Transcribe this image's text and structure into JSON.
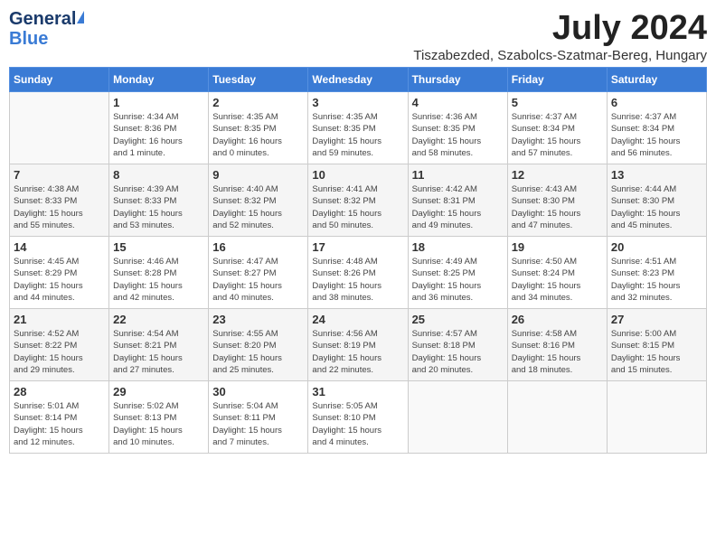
{
  "header": {
    "logo_general": "General",
    "logo_blue": "Blue",
    "month_title": "July 2024",
    "location": "Tiszabezded, Szabolcs-Szatmar-Bereg, Hungary"
  },
  "days_of_week": [
    "Sunday",
    "Monday",
    "Tuesday",
    "Wednesday",
    "Thursday",
    "Friday",
    "Saturday"
  ],
  "weeks": [
    [
      {
        "day": "",
        "info": ""
      },
      {
        "day": "1",
        "info": "Sunrise: 4:34 AM\nSunset: 8:36 PM\nDaylight: 16 hours\nand 1 minute."
      },
      {
        "day": "2",
        "info": "Sunrise: 4:35 AM\nSunset: 8:35 PM\nDaylight: 16 hours\nand 0 minutes."
      },
      {
        "day": "3",
        "info": "Sunrise: 4:35 AM\nSunset: 8:35 PM\nDaylight: 15 hours\nand 59 minutes."
      },
      {
        "day": "4",
        "info": "Sunrise: 4:36 AM\nSunset: 8:35 PM\nDaylight: 15 hours\nand 58 minutes."
      },
      {
        "day": "5",
        "info": "Sunrise: 4:37 AM\nSunset: 8:34 PM\nDaylight: 15 hours\nand 57 minutes."
      },
      {
        "day": "6",
        "info": "Sunrise: 4:37 AM\nSunset: 8:34 PM\nDaylight: 15 hours\nand 56 minutes."
      }
    ],
    [
      {
        "day": "7",
        "info": "Sunrise: 4:38 AM\nSunset: 8:33 PM\nDaylight: 15 hours\nand 55 minutes."
      },
      {
        "day": "8",
        "info": "Sunrise: 4:39 AM\nSunset: 8:33 PM\nDaylight: 15 hours\nand 53 minutes."
      },
      {
        "day": "9",
        "info": "Sunrise: 4:40 AM\nSunset: 8:32 PM\nDaylight: 15 hours\nand 52 minutes."
      },
      {
        "day": "10",
        "info": "Sunrise: 4:41 AM\nSunset: 8:32 PM\nDaylight: 15 hours\nand 50 minutes."
      },
      {
        "day": "11",
        "info": "Sunrise: 4:42 AM\nSunset: 8:31 PM\nDaylight: 15 hours\nand 49 minutes."
      },
      {
        "day": "12",
        "info": "Sunrise: 4:43 AM\nSunset: 8:30 PM\nDaylight: 15 hours\nand 47 minutes."
      },
      {
        "day": "13",
        "info": "Sunrise: 4:44 AM\nSunset: 8:30 PM\nDaylight: 15 hours\nand 45 minutes."
      }
    ],
    [
      {
        "day": "14",
        "info": "Sunrise: 4:45 AM\nSunset: 8:29 PM\nDaylight: 15 hours\nand 44 minutes."
      },
      {
        "day": "15",
        "info": "Sunrise: 4:46 AM\nSunset: 8:28 PM\nDaylight: 15 hours\nand 42 minutes."
      },
      {
        "day": "16",
        "info": "Sunrise: 4:47 AM\nSunset: 8:27 PM\nDaylight: 15 hours\nand 40 minutes."
      },
      {
        "day": "17",
        "info": "Sunrise: 4:48 AM\nSunset: 8:26 PM\nDaylight: 15 hours\nand 38 minutes."
      },
      {
        "day": "18",
        "info": "Sunrise: 4:49 AM\nSunset: 8:25 PM\nDaylight: 15 hours\nand 36 minutes."
      },
      {
        "day": "19",
        "info": "Sunrise: 4:50 AM\nSunset: 8:24 PM\nDaylight: 15 hours\nand 34 minutes."
      },
      {
        "day": "20",
        "info": "Sunrise: 4:51 AM\nSunset: 8:23 PM\nDaylight: 15 hours\nand 32 minutes."
      }
    ],
    [
      {
        "day": "21",
        "info": "Sunrise: 4:52 AM\nSunset: 8:22 PM\nDaylight: 15 hours\nand 29 minutes."
      },
      {
        "day": "22",
        "info": "Sunrise: 4:54 AM\nSunset: 8:21 PM\nDaylight: 15 hours\nand 27 minutes."
      },
      {
        "day": "23",
        "info": "Sunrise: 4:55 AM\nSunset: 8:20 PM\nDaylight: 15 hours\nand 25 minutes."
      },
      {
        "day": "24",
        "info": "Sunrise: 4:56 AM\nSunset: 8:19 PM\nDaylight: 15 hours\nand 22 minutes."
      },
      {
        "day": "25",
        "info": "Sunrise: 4:57 AM\nSunset: 8:18 PM\nDaylight: 15 hours\nand 20 minutes."
      },
      {
        "day": "26",
        "info": "Sunrise: 4:58 AM\nSunset: 8:16 PM\nDaylight: 15 hours\nand 18 minutes."
      },
      {
        "day": "27",
        "info": "Sunrise: 5:00 AM\nSunset: 8:15 PM\nDaylight: 15 hours\nand 15 minutes."
      }
    ],
    [
      {
        "day": "28",
        "info": "Sunrise: 5:01 AM\nSunset: 8:14 PM\nDaylight: 15 hours\nand 12 minutes."
      },
      {
        "day": "29",
        "info": "Sunrise: 5:02 AM\nSunset: 8:13 PM\nDaylight: 15 hours\nand 10 minutes."
      },
      {
        "day": "30",
        "info": "Sunrise: 5:04 AM\nSunset: 8:11 PM\nDaylight: 15 hours\nand 7 minutes."
      },
      {
        "day": "31",
        "info": "Sunrise: 5:05 AM\nSunset: 8:10 PM\nDaylight: 15 hours\nand 4 minutes."
      },
      {
        "day": "",
        "info": ""
      },
      {
        "day": "",
        "info": ""
      },
      {
        "day": "",
        "info": ""
      }
    ]
  ]
}
